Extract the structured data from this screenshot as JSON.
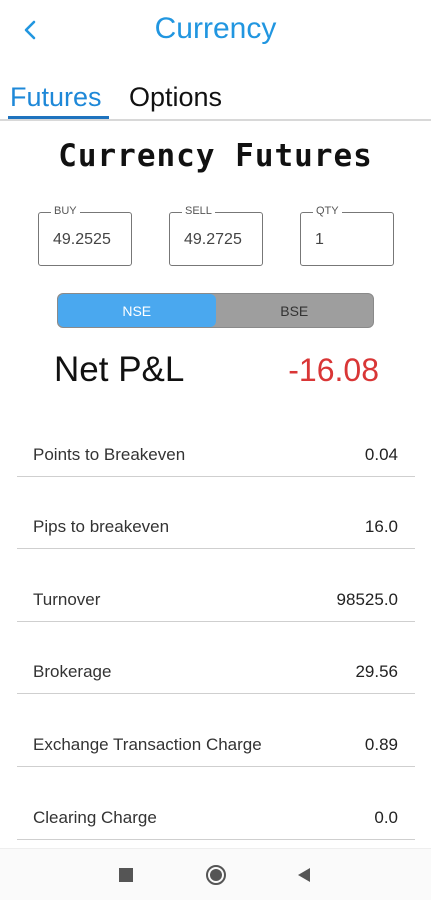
{
  "header": {
    "title": "Currency"
  },
  "tabs": [
    {
      "label": "Futures",
      "active": true
    },
    {
      "label": "Options",
      "active": false
    }
  ],
  "section_title": "Currency Futures",
  "fields": {
    "buy": {
      "label": "BUY",
      "value": "49.2525"
    },
    "sell": {
      "label": "SELL",
      "value": "49.2725"
    },
    "qty": {
      "label": "QTY",
      "value": "1"
    }
  },
  "exchange": {
    "options": [
      "NSE",
      "BSE"
    ],
    "selected": "NSE"
  },
  "net_pnl": {
    "label": "Net P&L",
    "value": "-16.08"
  },
  "rows": [
    {
      "label": "Points to Breakeven",
      "value": "0.04"
    },
    {
      "label": "Pips to breakeven",
      "value": "16.0"
    },
    {
      "label": "Turnover",
      "value": "98525.0"
    },
    {
      "label": "Brokerage",
      "value": "29.56"
    },
    {
      "label": "Exchange Transaction Charge",
      "value": "0.89"
    },
    {
      "label": "Clearing Charge",
      "value": "0.0"
    }
  ],
  "colors": {
    "accent": "#2196e0",
    "loss": "#d93636",
    "toggle_active": "#4aa8ef"
  },
  "icons": {
    "back": "chevron-left-icon",
    "recents": "square-icon",
    "home": "circle-icon",
    "back_nav": "triangle-left-icon"
  }
}
